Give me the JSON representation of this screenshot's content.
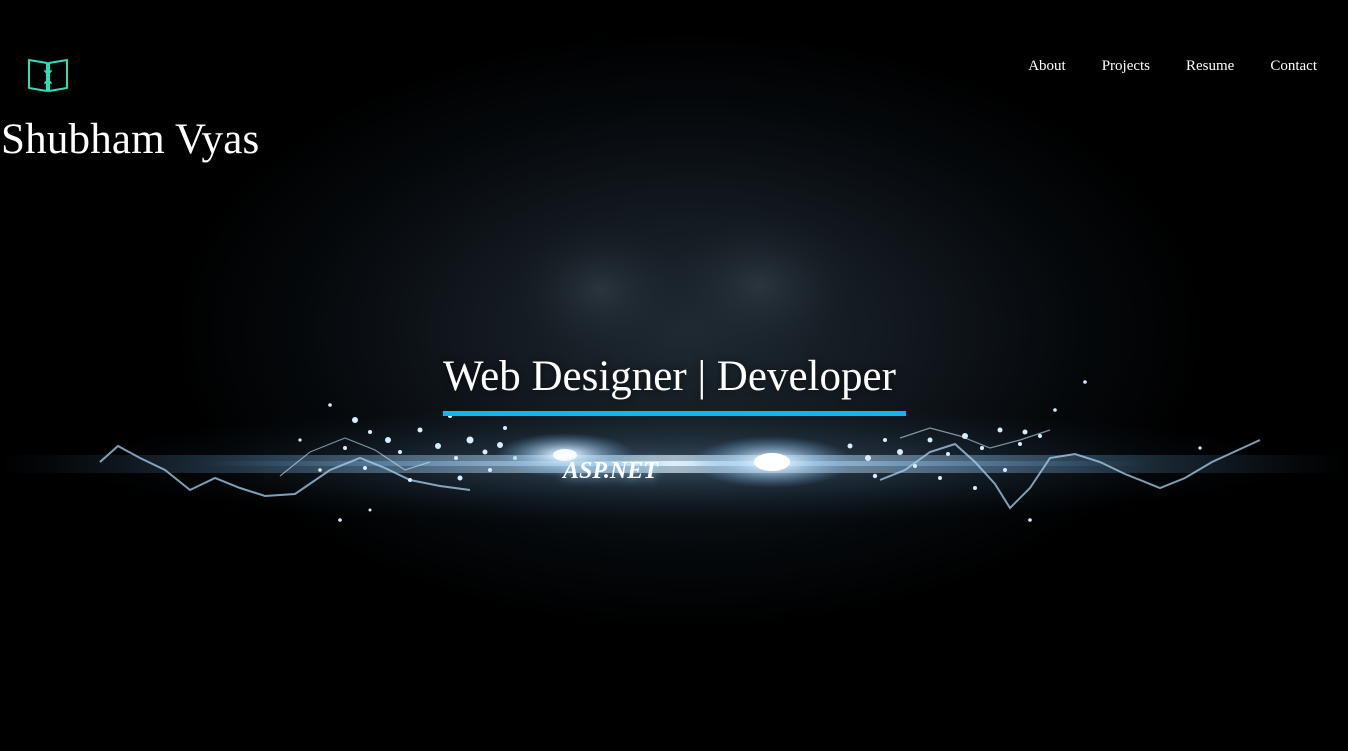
{
  "header": {
    "logo_icon": "book-arrows-icon",
    "brand_name": "Shubham Vyas",
    "accent_color": "#2be0b8"
  },
  "nav": {
    "items": [
      {
        "label": "About"
      },
      {
        "label": "Projects"
      },
      {
        "label": "Resume"
      },
      {
        "label": "Contact"
      }
    ]
  },
  "hero": {
    "tagline": "Web Designer | Developer",
    "underline_color": "#14b4ee",
    "skill": "ASP.NET",
    "background": "electric-energy-burst"
  }
}
